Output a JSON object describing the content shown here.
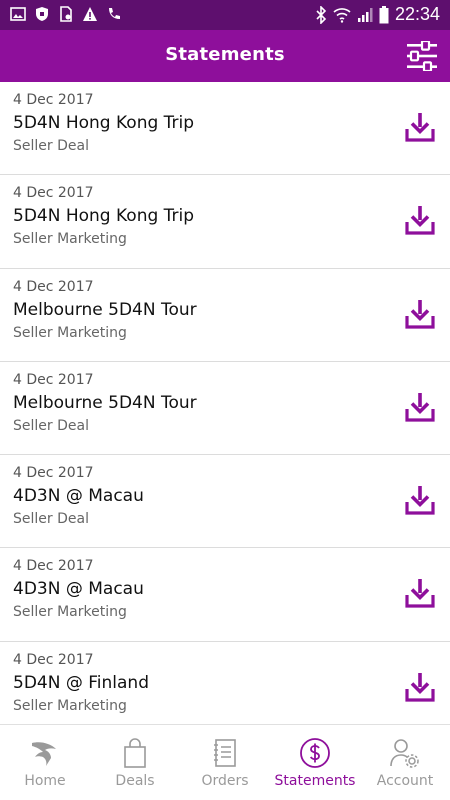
{
  "status": {
    "time": "22:34"
  },
  "header": {
    "title": "Statements",
    "filter_icon": "sliders-icon"
  },
  "colors": {
    "primary": "#8e0f9b",
    "status_bar": "#5e0f6e",
    "tab_inactive": "#9a9a9a"
  },
  "statements": [
    {
      "date": "4 Dec 2017",
      "title": "5D4N Hong Kong Trip",
      "type": "Seller Deal"
    },
    {
      "date": "4 Dec 2017",
      "title": "5D4N Hong Kong Trip",
      "type": "Seller Marketing"
    },
    {
      "date": "4 Dec 2017",
      "title": "Melbourne 5D4N Tour",
      "type": "Seller Marketing"
    },
    {
      "date": "4 Dec 2017",
      "title": "Melbourne 5D4N Tour",
      "type": "Seller Deal"
    },
    {
      "date": "4 Dec 2017",
      "title": "4D3N @ Macau",
      "type": "Seller Deal"
    },
    {
      "date": "4 Dec 2017",
      "title": "4D3N @ Macau",
      "type": "Seller Marketing"
    },
    {
      "date": "4 Dec 2017",
      "title": "5D4N @ Finland",
      "type": "Seller Marketing"
    }
  ],
  "tabs": [
    {
      "label": "Home",
      "icon": "home-logo-icon",
      "active": false
    },
    {
      "label": "Deals",
      "icon": "shopping-bag-icon",
      "active": false
    },
    {
      "label": "Orders",
      "icon": "notebook-icon",
      "active": false
    },
    {
      "label": "Statements",
      "icon": "dollar-circle-icon",
      "active": true
    },
    {
      "label": "Account",
      "icon": "user-gear-icon",
      "active": false
    }
  ]
}
